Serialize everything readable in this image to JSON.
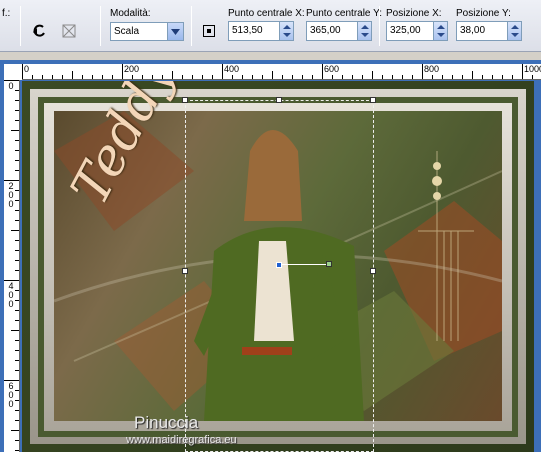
{
  "toolbar": {
    "leftcut_label": "f.:",
    "mode": {
      "label": "Modalità:",
      "value": "Scala"
    },
    "center_x": {
      "label": "Punto centrale X:",
      "value": "513,50"
    },
    "center_y": {
      "label": "Punto centrale Y:",
      "value": "365,00"
    },
    "pos_x": {
      "label": "Posizione X:",
      "value": "325,00"
    },
    "pos_y": {
      "label": "Posizione Y:",
      "value": "38,00"
    }
  },
  "ruler": {
    "h_labels": [
      "0",
      "200",
      "400",
      "600",
      "800",
      "1000"
    ],
    "v_labels": [
      "0",
      "200",
      "400",
      "600"
    ]
  },
  "image": {
    "title_script": "Teddy",
    "author": "Pinuccia",
    "website": "www.maidiregrafica.eu"
  },
  "colors": {
    "toolbar_bg": "#dcdfe8",
    "canvas_bg": "#3d6fb8",
    "frame_green": "#4a5a30"
  }
}
